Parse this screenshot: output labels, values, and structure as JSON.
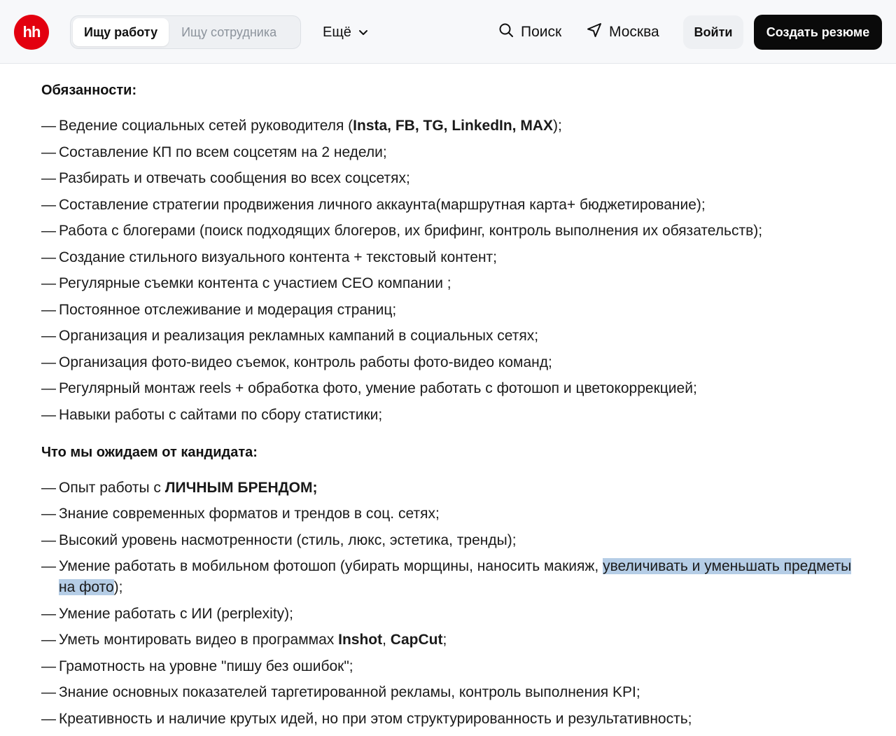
{
  "header": {
    "logo_text": "hh",
    "seg_active": "Ищу работу",
    "seg_inactive": "Ищу сотрудника",
    "more_label": "Ещё",
    "search_label": "Поиск",
    "city_label": "Москва",
    "login_label": "Войти",
    "create_resume_label": "Создать резюме",
    "brand_color": "#e3000f"
  },
  "duties": {
    "title": "Обязанности:",
    "items": {
      "i0": {
        "a": "Ведение социальных сетей руководителя (",
        "b": "Insta, FB, TG, LinkedIn, MAX",
        "c": ");"
      },
      "i1": "Составление КП по всем соцсетям на 2 недели;",
      "i2": "Разбирать и отвечать сообщения во всех соцсетях;",
      "i3": "Составление стратегии продвижения личного аккаунта(маршрутная карта+ бюджетирование);",
      "i4": "Работа с блогерами (поиск подходящих блогеров, их брифинг, контроль выполнения их обязательств);",
      "i5": "Создание стильного визуального контента + текстовый контент;",
      "i6": "Регулярные съемки контента с участием CEO компании ;",
      "i7": "Постоянное отслеживание и модерация страниц;",
      "i8": "Организация и реализация рекламных кампаний в социальных сетях;",
      "i9": "Организация фото-видео съемок, контроль работы фото-видео команд;",
      "i10": "Регулярный монтаж reels + обработка фото, умение работать с фотошоп и цветокоррекцией;",
      "i11": "Навыки работы с сайтами по сбору статистики;"
    }
  },
  "expect": {
    "title": "Что мы ожидаем от кандидата:",
    "items": {
      "i0": {
        "a": "Опыт работы с ",
        "b": "ЛИЧНЫМ БРЕНДОМ;"
      },
      "i1": "Знание современных форматов и трендов в соц. сетях;",
      "i2": "Высокий уровень насмотренности (стиль, люкс, эстетика, тренды);",
      "i3": {
        "a": "Умение работать в мобильном фотошоп (убирать морщины, наносить макияж, ",
        "hl": "увеличивать и уменьшать предметы на фото",
        "c": ");"
      },
      "i4": "Умение работать с ИИ (perplexity);",
      "i5": {
        "a": "Уметь монтировать видео в программах ",
        "b1": "Inshot",
        "sep": ", ",
        "b2": "CapCut",
        "c": ";"
      },
      "i6": "Грамотность на уровне \"пишу без ошибок\";",
      "i7": "Знание основных показателей таргетированной рекламы, контроль выполнения KPI;",
      "i8": "Креативность и наличие крутых идей, но при этом структурированность и результативность;"
    }
  }
}
